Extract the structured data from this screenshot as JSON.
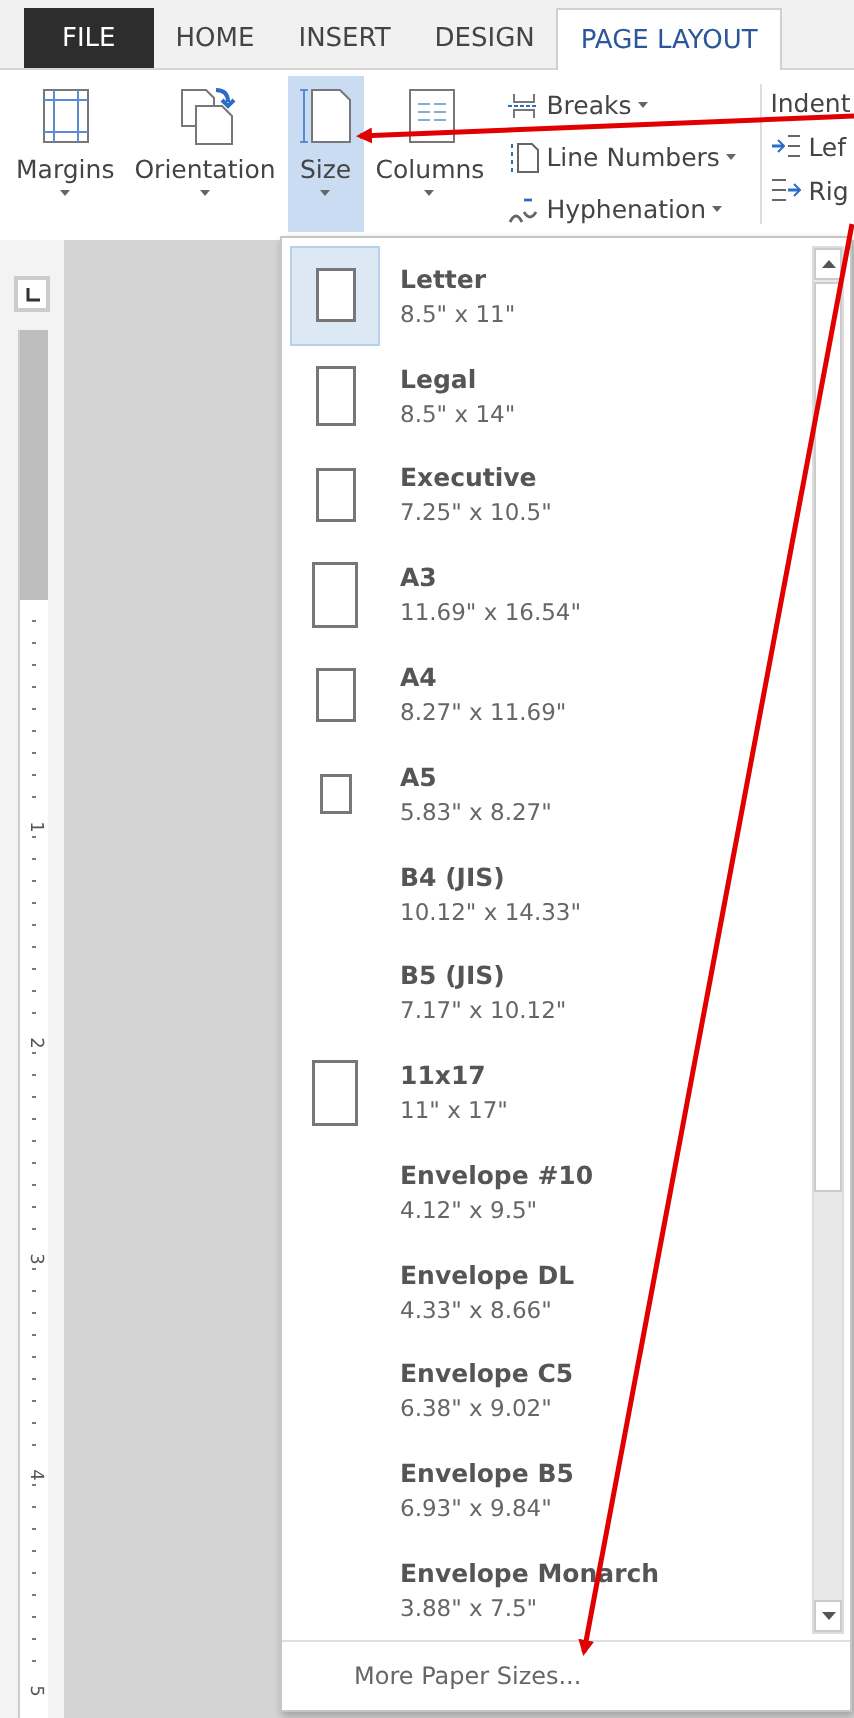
{
  "tabs": [
    {
      "label": "FILE",
      "kind": "file",
      "selected": false
    },
    {
      "label": "HOME",
      "kind": "tab",
      "selected": false
    },
    {
      "label": "INSERT",
      "kind": "tab",
      "selected": false
    },
    {
      "label": "DESIGN",
      "kind": "tab",
      "selected": false
    },
    {
      "label": "PAGE LAYOUT",
      "kind": "tab",
      "selected": true
    }
  ],
  "ribbon": {
    "large_buttons": [
      {
        "label": "Margins",
        "kind": "margins",
        "pressed": false
      },
      {
        "label": "Orientation",
        "kind": "orientation",
        "pressed": false
      },
      {
        "label": "Size",
        "kind": "size",
        "pressed": true
      },
      {
        "label": "Columns",
        "kind": "columns",
        "pressed": false
      }
    ],
    "small_buttons": [
      {
        "label": "Breaks",
        "kind": "breaks"
      },
      {
        "label": "Line Numbers",
        "kind": "line-numbers"
      },
      {
        "label": "Hyphenation",
        "kind": "hyphenation"
      }
    ],
    "indent": {
      "title": "Indent",
      "items": [
        {
          "label": "Lef",
          "kind": "left"
        },
        {
          "label": "Rig",
          "kind": "right"
        }
      ]
    }
  },
  "ruler": {
    "marks": [
      "1",
      "2",
      "3",
      "4",
      "5"
    ]
  },
  "size_menu": {
    "items": [
      {
        "name": "Letter",
        "dims": "8.5\" x 11\"",
        "kind": "medium",
        "selected": true
      },
      {
        "name": "Legal",
        "dims": "8.5\" x 14\"",
        "kind": "tall",
        "selected": false
      },
      {
        "name": "Executive",
        "dims": "7.25\" x 10.5\"",
        "kind": "medium",
        "selected": false
      },
      {
        "name": "A3",
        "dims": "11.69\" x 16.54\"",
        "kind": "large",
        "selected": false
      },
      {
        "name": "A4",
        "dims": "8.27\" x 11.69\"",
        "kind": "medium",
        "selected": false
      },
      {
        "name": "A5",
        "dims": "5.83\" x 8.27\"",
        "kind": "small",
        "selected": false
      },
      {
        "name": "B4 (JIS)",
        "dims": "10.12\" x 14.33\"",
        "kind": "plain",
        "selected": false
      },
      {
        "name": "B5 (JIS)",
        "dims": "7.17\" x 10.12\"",
        "kind": "plain",
        "selected": false
      },
      {
        "name": "11x17",
        "dims": "11\" x 17\"",
        "kind": "large",
        "selected": false
      },
      {
        "name": "Envelope #10",
        "dims": "4.12\" x 9.5\"",
        "kind": "plain",
        "selected": false
      },
      {
        "name": "Envelope DL",
        "dims": "4.33\" x 8.66\"",
        "kind": "plain",
        "selected": false
      },
      {
        "name": "Envelope C5",
        "dims": "6.38\" x 9.02\"",
        "kind": "plain",
        "selected": false
      },
      {
        "name": "Envelope B5",
        "dims": "6.93\" x 9.84\"",
        "kind": "plain",
        "selected": false
      },
      {
        "name": "Envelope Monarch",
        "dims": "3.88\" x 7.5\"",
        "kind": "plain",
        "selected": false
      }
    ],
    "footer": "More Paper Sizes..."
  }
}
